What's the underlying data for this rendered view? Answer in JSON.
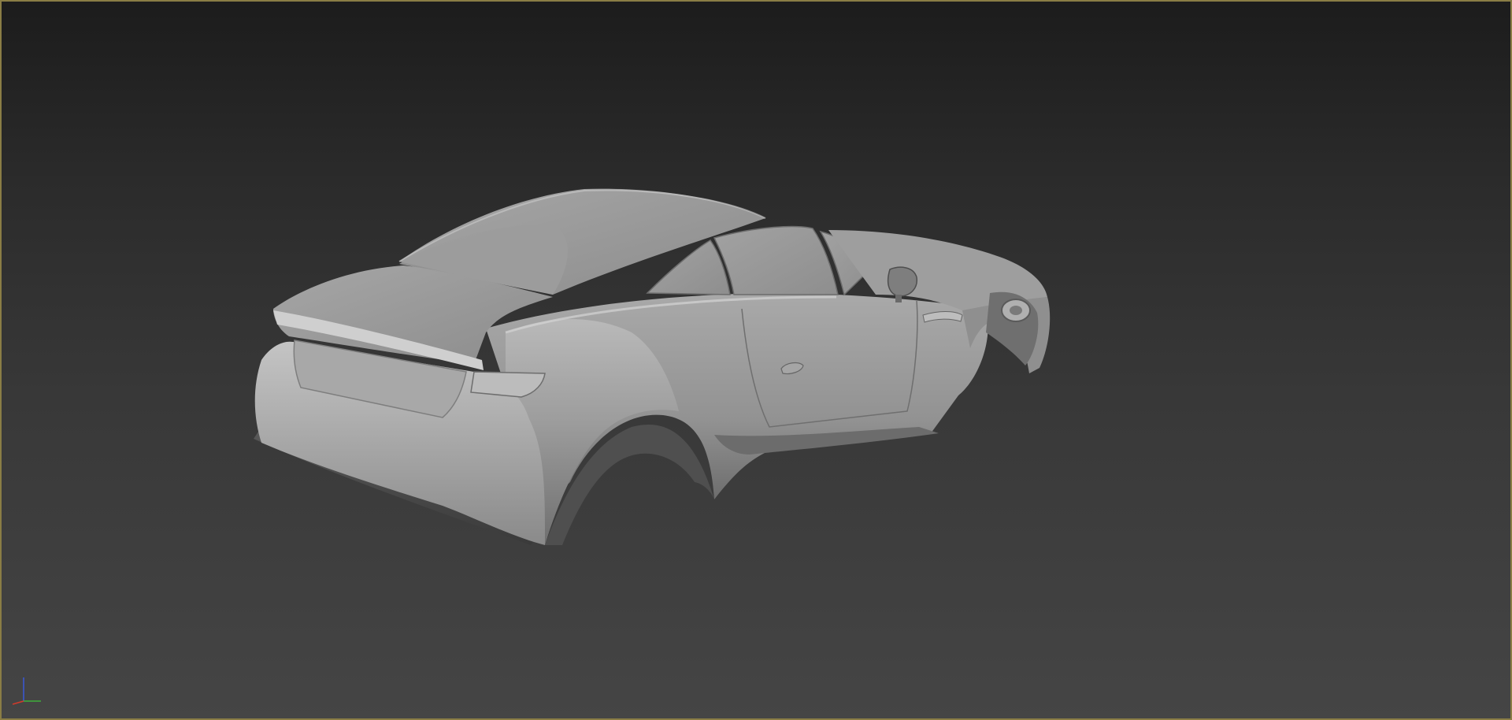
{
  "viewport": {
    "view": "perspective",
    "shading": "default-shading",
    "background_top": "#1c1c1c",
    "background_bottom": "#454545",
    "active_border_color": "#8a7d45"
  },
  "model": {
    "object": "car-body-shell",
    "base_color": "#9a9a9a",
    "highlight_color": "#c8c8c8",
    "shadow_color": "#3e3e3e"
  },
  "axis_gizmo": {
    "x_color": "#d23b2a",
    "y_color": "#3fae3a",
    "z_color": "#3a58d8"
  }
}
